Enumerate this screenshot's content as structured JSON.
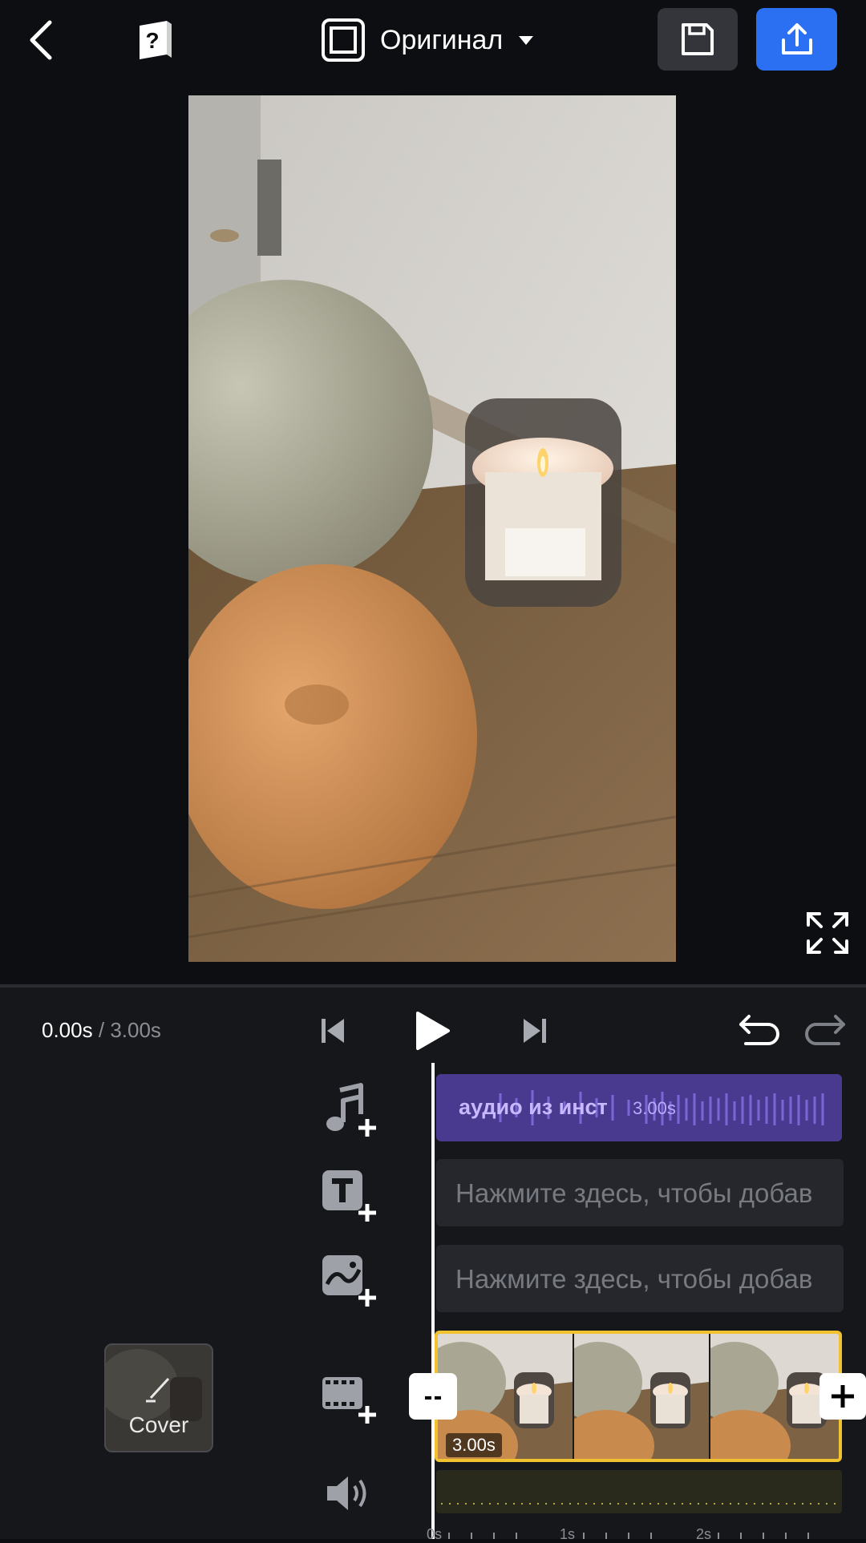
{
  "toolbar": {
    "aspect_label": "Оригинал",
    "help_glyph": "?",
    "icons": {
      "back": "chevron-left-icon",
      "help": "help-book-icon",
      "aspect": "aspect-ratio-icon",
      "dropdown": "caret-down-icon",
      "save": "floppy-disk-icon",
      "export": "share-upload-icon"
    },
    "accent_color": "#2b6ff2"
  },
  "playback": {
    "current_time": "0.00s",
    "separator": "/",
    "total_time": "3.00s"
  },
  "tracks": {
    "audio": {
      "label": "аудио из инст",
      "duration": "3.00s",
      "color": "#4a3a8f"
    },
    "text_hint": "Нажмите здесь, чтобы добав",
    "sticker_hint": "Нажмите здесь, чтобы добав",
    "video": {
      "duration": "3.00s",
      "border_color": "#f0c230"
    },
    "trim_label": "--"
  },
  "cover": {
    "label": "Cover"
  },
  "ruler_labels": [
    "0s",
    "1s",
    "2s"
  ]
}
